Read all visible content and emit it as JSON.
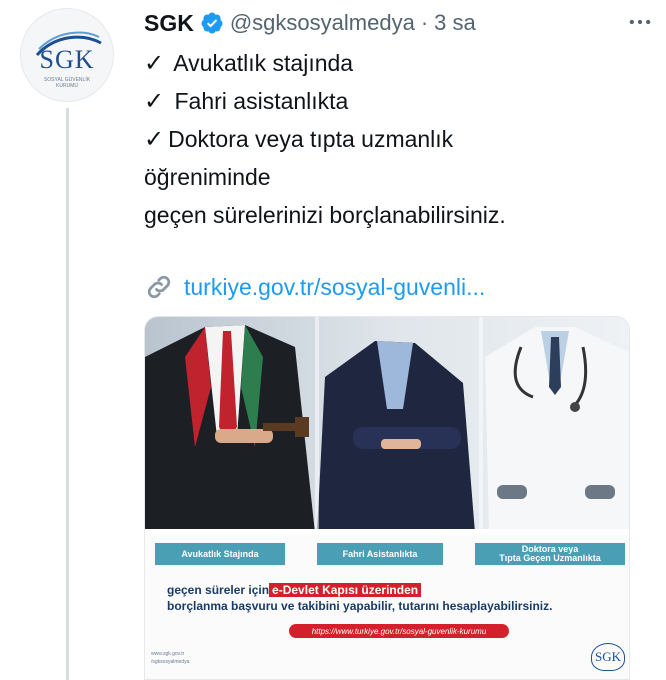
{
  "avatar": {
    "logo_text": "SGK",
    "logo_subtext": "SOSYAL GÜVENLİK KURUMU"
  },
  "header": {
    "display_name": "SGK",
    "handle": "@sgksosyalmedya",
    "separator": "·",
    "time": "3 sa"
  },
  "tweet": {
    "check_mark": "✓",
    "lines": [
      "Avukatlık stajında",
      "Fahri asistanlıkta",
      "Doktora veya tıpta uzmanlık",
      "öğreniminde",
      "geçen sürelerinizi borçlanabilirsiniz."
    ],
    "link_text": "turkiye.gov.tr/sosyal-guvenli..."
  },
  "card": {
    "label_1": "Avukatlık Stajında",
    "label_2": "Fahri Asistanlıkta",
    "label_3a": "Doktora veya",
    "label_3b": "Tıpta Geçen Uzmanlıkta",
    "info_prefix": "geçen süreler için",
    "info_highlight": "e-Devlet Kapısı üzerinden",
    "info_line_2": "borçlanma başvuru ve takibini yapabilir, tutarını hesaplayabilirsiniz.",
    "url_pill": "https://www.turkiye.gov.tr/sosyal-guvenlik-kurumu",
    "footer_line_1": "www.sgk.gov.tr",
    "footer_line_2": "/sgksosyalmedya",
    "logo_text": "SGK"
  },
  "colors": {
    "link": "#1d9bf0",
    "verified": "#1d9bf0",
    "label_bg": "#4a9fb5",
    "highlight": "#d4202c",
    "brand": "#1d4f91"
  },
  "icons": {
    "verified": "verified-badge-icon",
    "more": "more-icon",
    "link": "link-icon"
  }
}
